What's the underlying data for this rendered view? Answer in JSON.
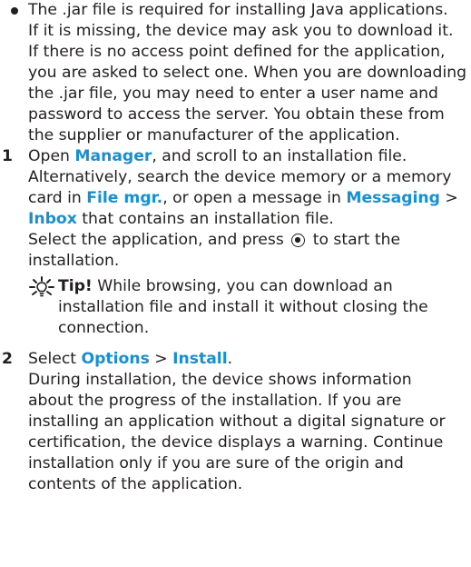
{
  "bullet_para": [
    "The .jar file is required for installing Java applications.",
    "If it is missing, the device may ask you to download it.",
    "If there is no access point defined for the application,",
    "you are asked to select one. When you are downloading",
    "the .jar file, you may need to enter a user name and",
    "password to access the server. You obtain these from",
    "the supplier or manufacturer of the application."
  ],
  "step1": {
    "num": "1",
    "l1_a": "Open ",
    "l1_b": "Manager",
    "l1_c": ", and scroll to an installation file.",
    "l2": "Alternatively, search the device memory or a memory",
    "l3_a": "card in ",
    "l3_b": "File mgr.",
    "l3_c": ", or open a message in ",
    "l3_d": "Messaging",
    "l3_e": " >",
    "l4_a": "Inbox",
    "l4_b": " that contains an installation file.",
    "l5_a": "Select the application, and press ",
    "l5_b": " to start the",
    "l6": "installation."
  },
  "tip": {
    "label": "Tip!",
    "l1": " While browsing, you can download an",
    "l2": "installation file and install it without closing the",
    "l3": "connection."
  },
  "step2": {
    "num": "2",
    "l1_a": "Select ",
    "l1_b": "Options",
    "l1_c": " > ",
    "l1_d": "Install",
    "l1_e": ".",
    "lines": [
      "During installation, the device shows information",
      "about the progress of the installation. If you are",
      "installing an application without a digital signature or",
      "certification, the device displays a warning. Continue",
      "installation only if you are sure of the origin and",
      "contents of the application."
    ]
  },
  "colors": {
    "link": "#1a8fd0",
    "text": "#231f20"
  },
  "icons": {
    "select_key": "select-key-icon",
    "tip": "tip-lightbulb-icon"
  }
}
